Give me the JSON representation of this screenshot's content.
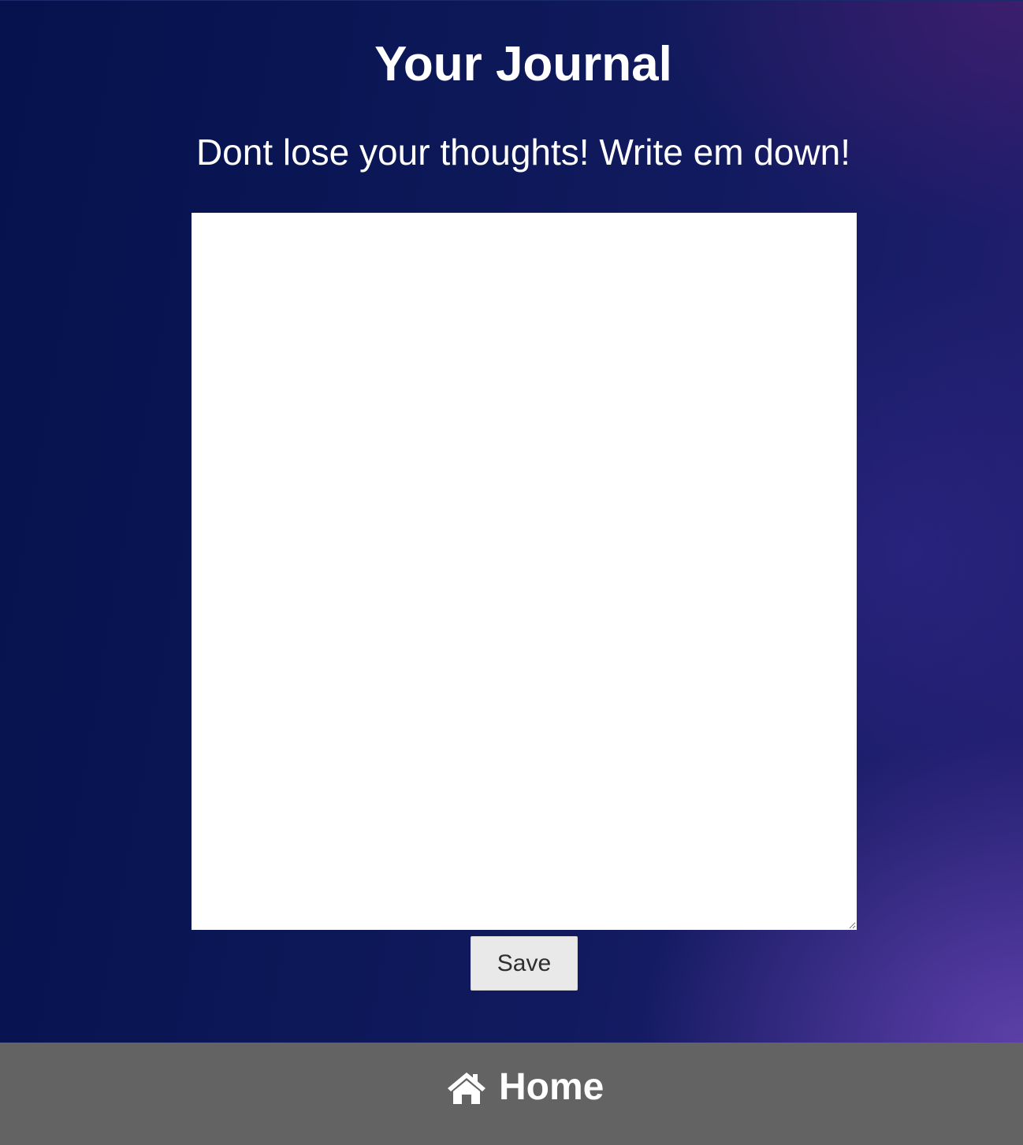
{
  "header": {
    "title": "Your Journal",
    "subtitle": "Dont lose your thoughts! Write em down!"
  },
  "journal": {
    "value": "",
    "placeholder": ""
  },
  "actions": {
    "save_label": "Save"
  },
  "footer": {
    "home_label": "Home",
    "home_icon": "home-icon"
  },
  "colors": {
    "background_dark": "#081552",
    "background_accent": "#5f41aa",
    "footer": "#636363",
    "text": "#ffffff",
    "button": "#e9e9e9"
  }
}
